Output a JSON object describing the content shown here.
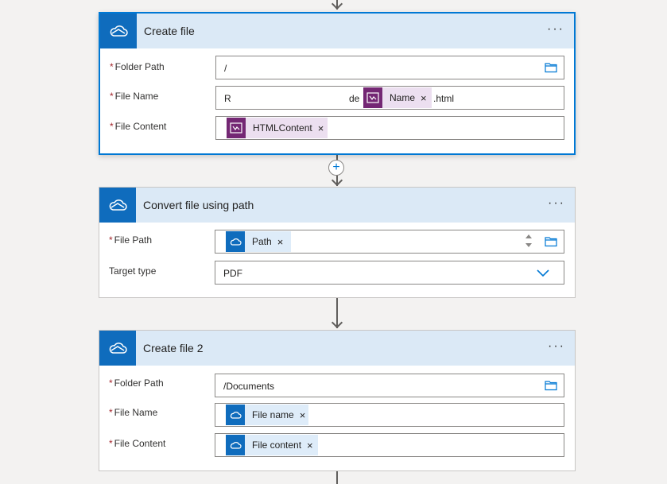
{
  "cards": [
    {
      "title": "Create file",
      "more": "···",
      "fields": [
        {
          "label": "Folder Path",
          "value": "/"
        },
        {
          "label": "File Name",
          "prefix_text": "R",
          "mid_text": "de",
          "token": "Name",
          "suffix_text": ".html"
        },
        {
          "label": "File Content",
          "token": "HTMLContent"
        }
      ]
    },
    {
      "title": "Convert file using path",
      "more": "···",
      "fields": [
        {
          "label": "File Path",
          "token": "Path"
        },
        {
          "label": "Target type",
          "value": "PDF"
        }
      ]
    },
    {
      "title": "Create file 2",
      "more": "···",
      "fields": [
        {
          "label": "Folder Path",
          "value": "/Documents"
        },
        {
          "label": "File Name",
          "token": "File name"
        },
        {
          "label": "File Content",
          "token": "File content"
        }
      ]
    }
  ],
  "required_marker": "*",
  "token_remove": "×",
  "add_step": "+",
  "colors": {
    "accent": "#0078d4",
    "onedrive_icon_bg": "#0f6cbd",
    "powerapps_icon_bg": "#742774",
    "header_bg": "#dbe9f6"
  }
}
